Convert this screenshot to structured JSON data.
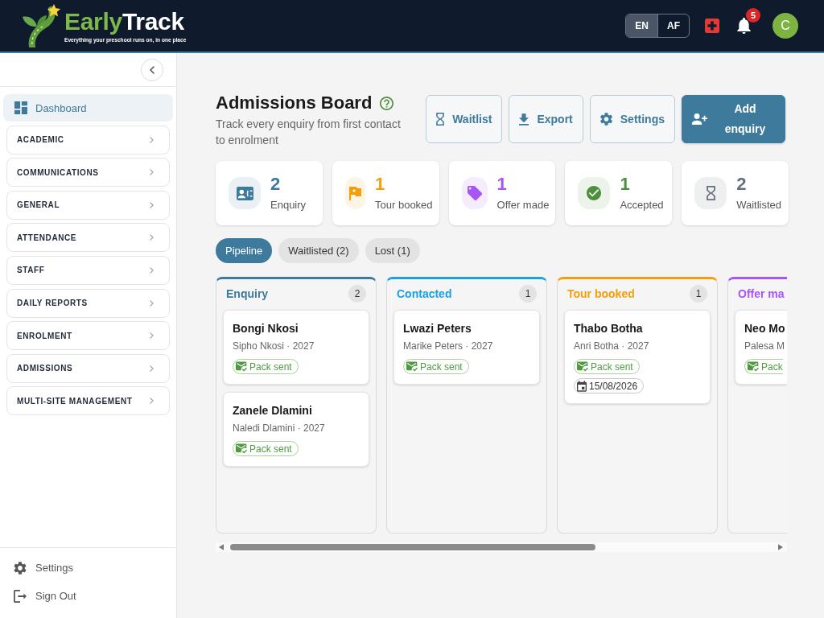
{
  "header": {
    "brand": {
      "accent": "Early",
      "rest": "Track",
      "tagline": "Everything your preschool runs on, in one place"
    },
    "languages": [
      {
        "label": "EN",
        "selected": true
      },
      {
        "label": "AF",
        "selected": false
      }
    ],
    "notifications": {
      "count": "5"
    },
    "user": {
      "initial": "C"
    }
  },
  "sidebar": {
    "dashboard": {
      "label": "Dashboard",
      "selected": true
    },
    "groups": [
      {
        "label": "ACADEMIC",
        "expanded": false
      },
      {
        "label": "COMMUNICATIONS",
        "expanded": false
      },
      {
        "label": "GENERAL",
        "expanded": false
      },
      {
        "label": "ATTENDANCE",
        "expanded": false
      },
      {
        "label": "STAFF",
        "expanded": false
      },
      {
        "label": "DAILY REPORTS",
        "expanded": false
      },
      {
        "label": "ENROLMENT",
        "expanded": false
      },
      {
        "label": "ADMISSIONS",
        "expanded": false
      },
      {
        "label": "MULTI-SITE MANAGEMENT",
        "expanded": false
      }
    ],
    "footer": [
      {
        "label": "Settings"
      },
      {
        "label": "Sign Out"
      }
    ]
  },
  "page": {
    "title": "Admissions Board",
    "subtitle": "Track every enquiry from first contact to enrolment",
    "actions": [
      {
        "label": "Waitlist",
        "kind": "outline"
      },
      {
        "label": "Export",
        "kind": "outline"
      },
      {
        "label": "Settings",
        "kind": "outline"
      },
      {
        "label": "Add enquiry",
        "kind": "primary"
      }
    ]
  },
  "stats": [
    {
      "value": "2",
      "label": "Enquiry",
      "color": "#3d7a9c"
    },
    {
      "value": "1",
      "label": "Tour booked",
      "color": "#f59e0b"
    },
    {
      "value": "1",
      "label": "Offer made",
      "color": "#a855f7"
    },
    {
      "value": "1",
      "label": "Accepted",
      "color": "#4e8f3e"
    },
    {
      "value": "2",
      "label": "Waitlisted",
      "color": "#667080"
    }
  ],
  "tabs": [
    {
      "label": "Pipeline",
      "selected": true
    },
    {
      "label": "Waitlisted (2)",
      "selected": false
    },
    {
      "label": "Lost (1)",
      "selected": false
    }
  ],
  "board": {
    "columns": [
      {
        "title": "Enquiry",
        "count": "2",
        "color": "#3d7a9c",
        "cards": [
          {
            "name": "Bongi Nkosi",
            "detail": "Sipho Nkosi · 2027",
            "tags": [
              {
                "kind": "status",
                "label": "Pack sent"
              }
            ]
          },
          {
            "name": "Zanele Dlamini",
            "detail": "Naledi Dlamini · 2027",
            "tags": [
              {
                "kind": "status",
                "label": "Pack sent"
              }
            ]
          }
        ]
      },
      {
        "title": "Contacted",
        "count": "1",
        "color": "#1ba1e2",
        "cards": [
          {
            "name": "Lwazi Peters",
            "detail": "Marike Peters · 2027",
            "tags": [
              {
                "kind": "status",
                "label": "Pack sent"
              }
            ]
          }
        ]
      },
      {
        "title": "Tour booked",
        "count": "1",
        "color": "#f59e0b",
        "cards": [
          {
            "name": "Thabo Botha",
            "detail": "Anri Botha · 2027",
            "tags": [
              {
                "kind": "status",
                "label": "Pack sent"
              },
              {
                "kind": "date",
                "label": "15/08/2026"
              }
            ]
          }
        ]
      },
      {
        "title": "Offer ma",
        "color": "#a855f7",
        "cards": [
          {
            "name": "Neo Mo",
            "detail": "Palesa M",
            "tags": [
              {
                "kind": "status",
                "label": "Pack"
              }
            ]
          }
        ]
      }
    ]
  }
}
